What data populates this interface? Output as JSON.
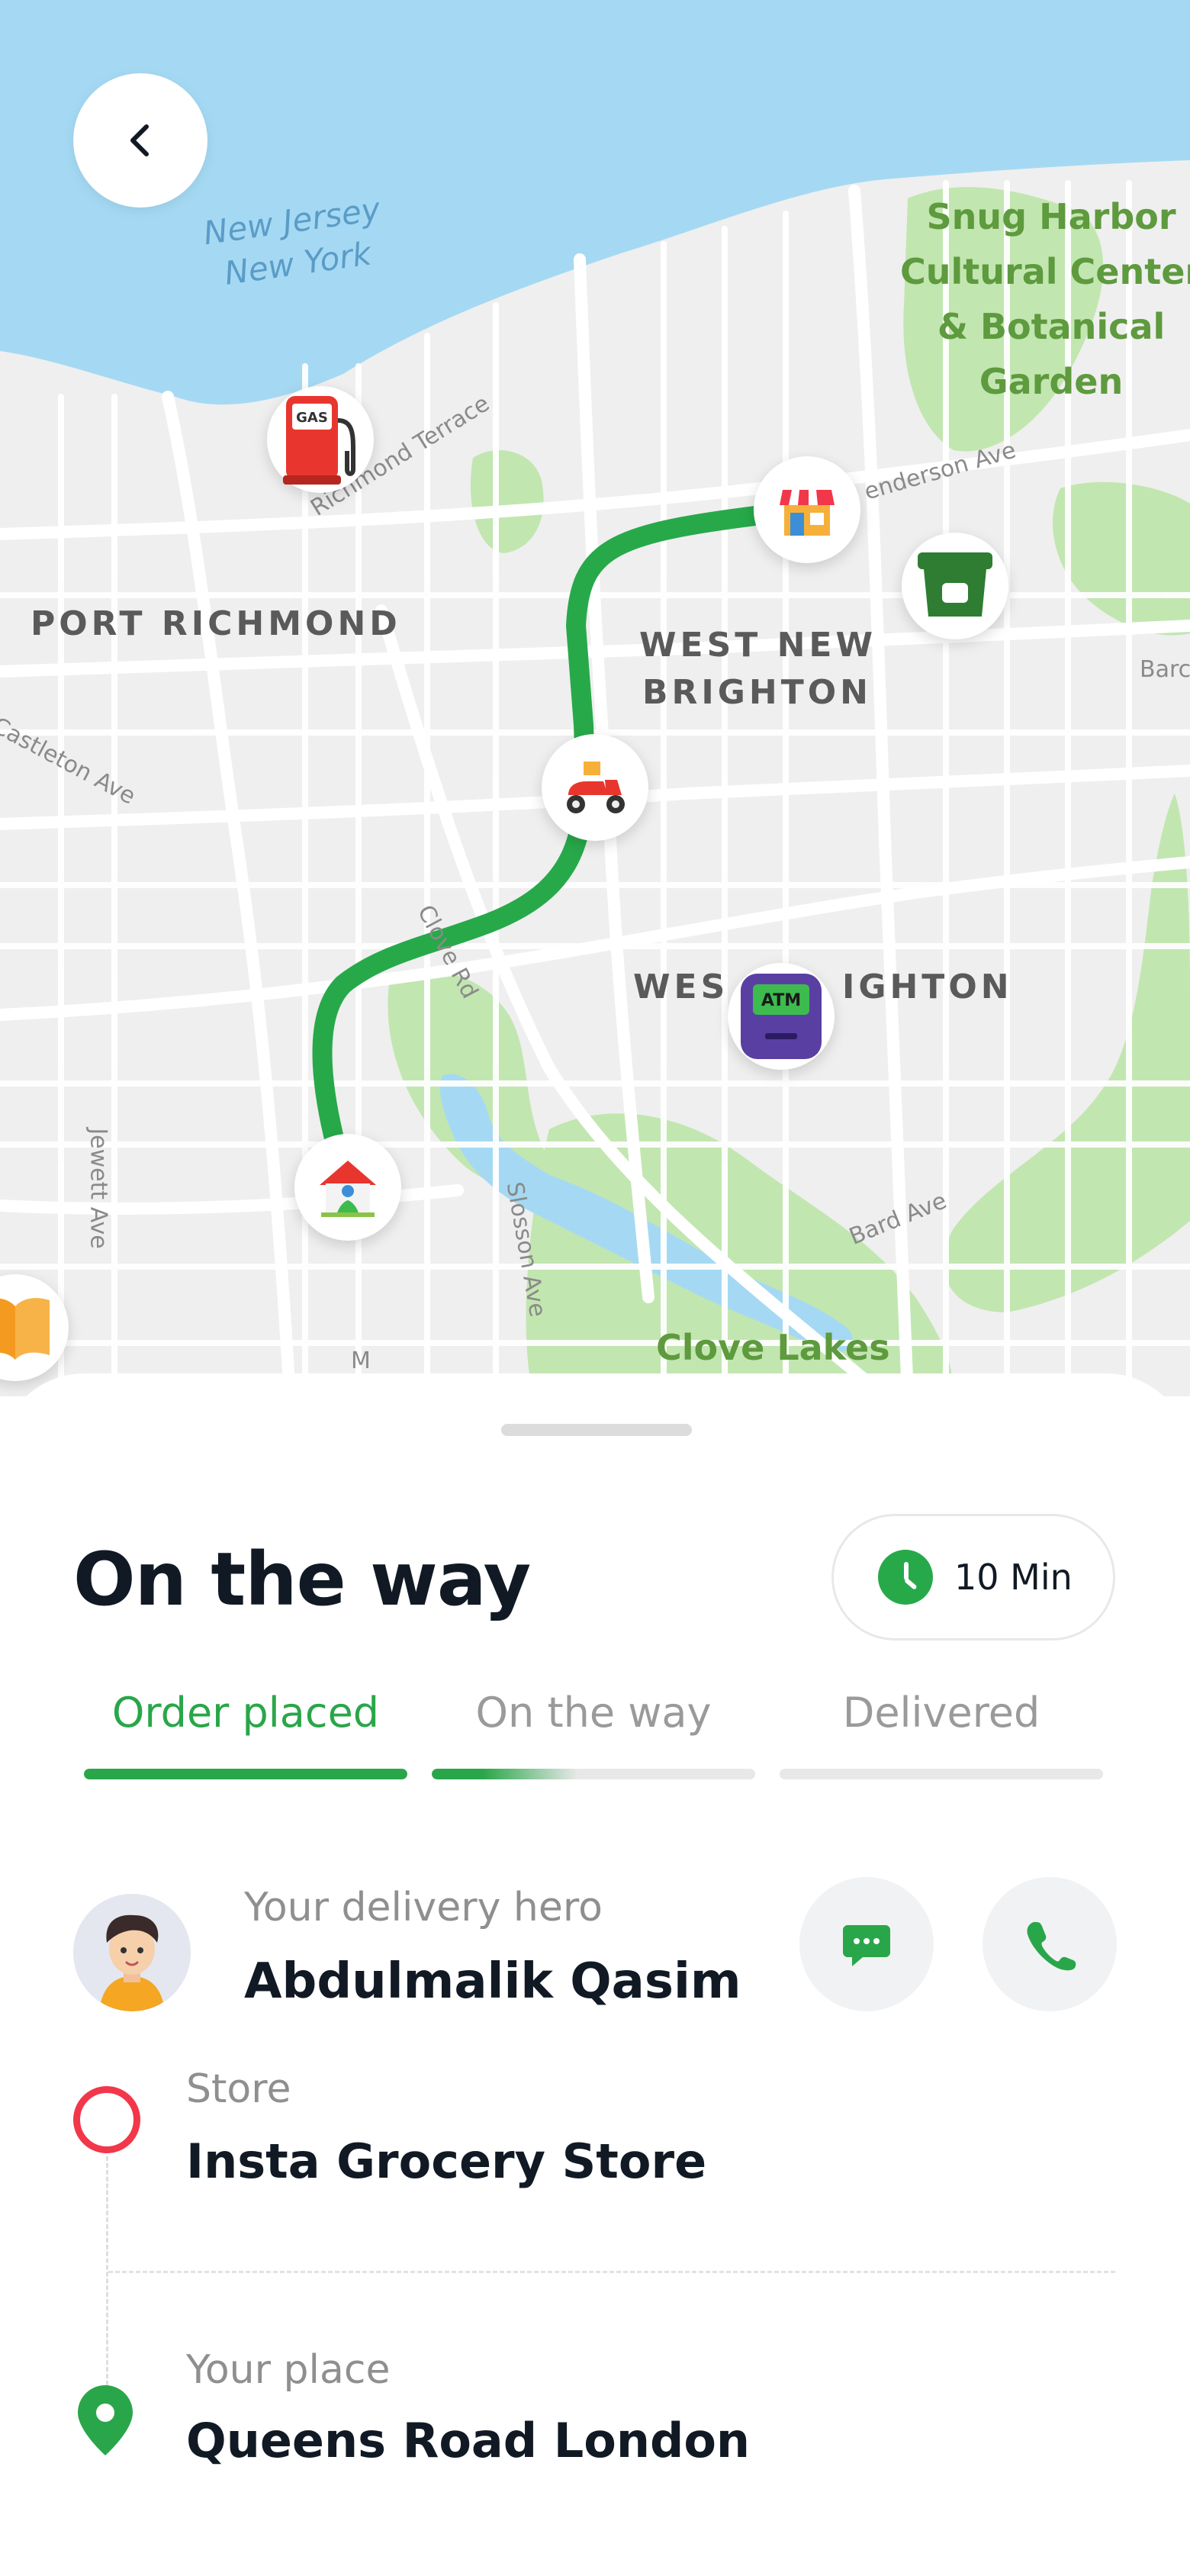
{
  "map": {
    "area_labels": [
      "PORT RICHMOND",
      "WEST NEW",
      "BRIGHTON",
      "WES",
      "IGHTON"
    ],
    "water_labels": [
      "New Jersey",
      "New York"
    ],
    "park_labels": [
      "Snug Harbor",
      "Cultural Center",
      "& Botanical",
      "Garden",
      "Clove Lakes"
    ],
    "street_labels": [
      "Richmond Terrace",
      "enderson Ave",
      "Castleton Ave",
      "Clove Rd",
      "Jewett Ave",
      "Slosson Ave",
      "Bard Ave",
      "Barc",
      "M"
    ],
    "marker_texts": {
      "gas": "GAS",
      "atm": "ATM"
    },
    "route_color": "#27a94a",
    "water_color": "#a5d9f3",
    "park_color": "#c2e6b0",
    "icons": [
      "back-chevron-icon",
      "gas-station-icon",
      "shop-icon",
      "grocery-bag-icon",
      "scooter-icon",
      "atm-icon",
      "home-icon",
      "book-icon"
    ]
  },
  "sheet": {
    "title": "On the way",
    "eta": "10 Min",
    "tabs": [
      {
        "label": "Order placed",
        "state": "active",
        "progress": 1.0
      },
      {
        "label": "On the way",
        "state": "in-progress",
        "progress": 0.45
      },
      {
        "label": "Delivered",
        "state": "pending",
        "progress": 0.0
      }
    ],
    "hero": {
      "caption": "Your delivery hero",
      "name": "Abdulmalik Qasim"
    },
    "store": {
      "caption": "Store",
      "name": "Insta Grocery Store"
    },
    "place": {
      "caption": "Your place",
      "name": "Queens Road London"
    },
    "accent_color": "#2aa64a",
    "store_color": "#f2374a"
  }
}
